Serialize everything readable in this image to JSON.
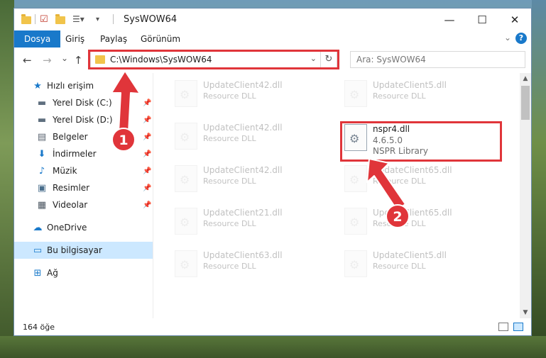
{
  "window": {
    "title": "SysWOW64",
    "controls": {
      "minimize": "—",
      "maximize": "☐",
      "close": "✕"
    }
  },
  "ribbon": {
    "tabs": [
      "Dosya",
      "Giriş",
      "Paylaş",
      "Görünüm"
    ],
    "help": "?"
  },
  "navigation": {
    "back": "←",
    "forward": "→",
    "recent": "⌄",
    "up": "↑",
    "address": "C:\\Windows\\SysWOW64",
    "refresh": "↻",
    "search_placeholder": "Ara: SysWOW64"
  },
  "sidebar": {
    "quick_access": "Hızlı erişim",
    "items": [
      {
        "label": "Yerel Disk (C:)",
        "icon": "drive-icon"
      },
      {
        "label": "Yerel Disk (D:)",
        "icon": "drive-icon"
      },
      {
        "label": "Belgeler",
        "icon": "documents-icon"
      },
      {
        "label": "İndirmeler",
        "icon": "downloads-icon"
      },
      {
        "label": "Müzik",
        "icon": "music-icon"
      },
      {
        "label": "Resimler",
        "icon": "pictures-icon"
      },
      {
        "label": "Videolar",
        "icon": "videos-icon"
      }
    ],
    "onedrive": "OneDrive",
    "this_pc": "Bu bilgisayar",
    "network": "Ağ"
  },
  "files": {
    "left_column": [
      {
        "name": "UpdateClient42.dll",
        "type": "Resource DLL"
      },
      {
        "name": "UpdateClient42.dll",
        "type": "Resource DLL"
      },
      {
        "name": "UpdateClient42.dll",
        "type": "Resource DLL"
      },
      {
        "name": "UpdateClient21.dll",
        "type": "Resource DLL"
      },
      {
        "name": "UpdateClient63.dll",
        "type": "Resource DLL"
      }
    ],
    "right_column": [
      {
        "name": "UpdateClient5.dll",
        "type": "Resource DLL"
      },
      {
        "name": "UpdateClient65.dll",
        "type": "Resource DLL"
      },
      {
        "name": "UpdateClient65.dll",
        "type": "Resource DLL"
      },
      {
        "name": "UpdateClient5.dll",
        "type": "Resource DLL"
      }
    ],
    "highlighted": {
      "name": "nspr4.dll",
      "version": "4.6.5.0",
      "description": "NSPR Library"
    }
  },
  "annotations": {
    "badge1": "1",
    "badge2": "2",
    "color": "#e0353a"
  },
  "status": {
    "item_count": "164 öğe"
  }
}
